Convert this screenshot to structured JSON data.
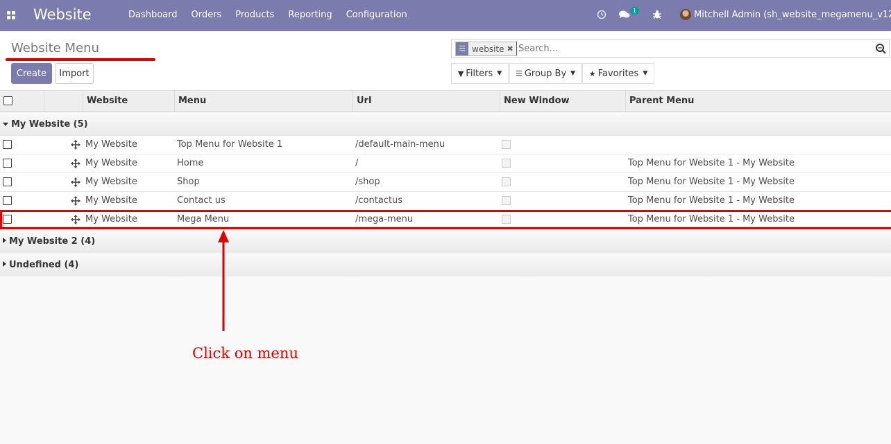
{
  "navbar": {
    "app_name": "Website",
    "menu_items": [
      "Dashboard",
      "Orders",
      "Products",
      "Reporting",
      "Configuration"
    ],
    "chat_badge": "1",
    "user": "Mitchell Admin (sh_website_megamenu_v12c)"
  },
  "control_panel": {
    "title": "Website Menu",
    "create_label": "Create",
    "import_label": "Import",
    "search": {
      "facet": "website",
      "placeholder": "Search..."
    },
    "filters_label": "Filters",
    "groupby_label": "Group By",
    "favorites_label": "Favorites"
  },
  "list": {
    "columns": [
      "Website",
      "Menu",
      "Url",
      "New Window",
      "Parent Menu"
    ],
    "groups": [
      {
        "label": "My Website (5)",
        "expanded": true,
        "rows": [
          {
            "website": "My Website",
            "menu": "Top Menu for Website 1",
            "url": "/default-main-menu",
            "new_window": false,
            "parent": ""
          },
          {
            "website": "My Website",
            "menu": "Home",
            "url": "/",
            "new_window": false,
            "parent": "Top Menu for Website 1 - My Website"
          },
          {
            "website": "My Website",
            "menu": "Shop",
            "url": "/shop",
            "new_window": false,
            "parent": "Top Menu for Website 1 - My Website"
          },
          {
            "website": "My Website",
            "menu": "Contact us",
            "url": "/contactus",
            "new_window": false,
            "parent": "Top Menu for Website 1 - My Website"
          },
          {
            "website": "My Website",
            "menu": "Mega Menu",
            "url": "/mega-menu",
            "new_window": false,
            "parent": "Top Menu for Website 1 - My Website"
          }
        ]
      },
      {
        "label": "My Website 2 (4)",
        "expanded": false
      },
      {
        "label": "Undefined (4)",
        "expanded": false
      }
    ]
  },
  "annotation": {
    "text": "Click on menu",
    "color": "#e00000"
  },
  "colors": {
    "navbar": "#7c7bad",
    "primary_button": "#7c7bad",
    "badge": "#00a09d",
    "annotation_red": "#e00000"
  }
}
